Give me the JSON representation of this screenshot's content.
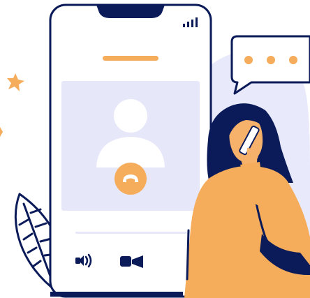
{
  "illustration": {
    "subject": "phone-call",
    "icons": [
      "signal-icon",
      "end-call-icon",
      "speaker-icon",
      "video-icon",
      "chat-bubble-icon",
      "sparkle-icon",
      "leaf-icon"
    ],
    "typing_dots": 3,
    "colors": {
      "navy": "#0b1b59",
      "orange": "#f5ac5b",
      "lavender": "#e8e9fb",
      "screen_panel": "#e6e8fa",
      "skin": "#f6b16a",
      "white": "#ffffff"
    }
  }
}
